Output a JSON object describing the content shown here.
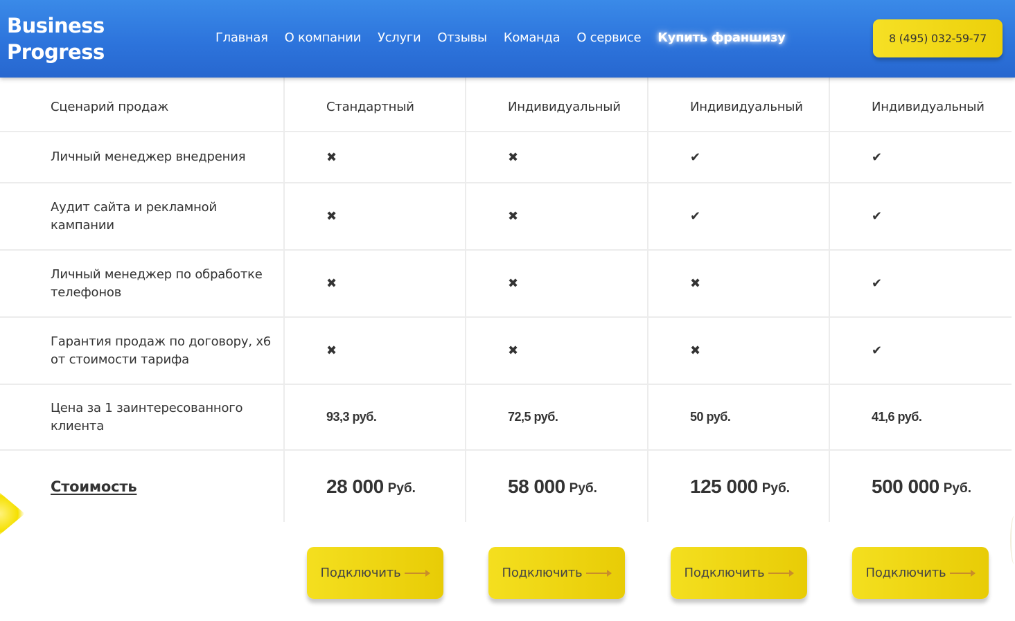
{
  "header": {
    "logo_line1": "Business",
    "logo_line2": "Progress",
    "nav": [
      {
        "label": "Главная"
      },
      {
        "label": "О компании"
      },
      {
        "label": "Услуги"
      },
      {
        "label": "Отзывы"
      },
      {
        "label": "Команда"
      },
      {
        "label": "О сервисе"
      },
      {
        "label": "Купить франшизу"
      }
    ],
    "phone": "8 (495) 032-59-77"
  },
  "table": {
    "rows": [
      {
        "label": "Сценарий продаж",
        "values": [
          "Стандартный",
          "Индивидуальный",
          "Индивидуальный",
          "Индивидуальный"
        ]
      },
      {
        "label": "Личный менеджер внедрения",
        "marks": [
          "cross",
          "cross",
          "check",
          "check"
        ]
      },
      {
        "label": "Аудит сайта и рекламной кампании",
        "marks": [
          "cross",
          "cross",
          "check",
          "check"
        ]
      },
      {
        "label": "Личный менеджер по обработке телефонов",
        "marks": [
          "cross",
          "cross",
          "cross",
          "check"
        ]
      },
      {
        "label": "Гарантия продаж по договору, х6 от стоимости тарифа",
        "marks": [
          "cross",
          "cross",
          "cross",
          "check"
        ]
      },
      {
        "label": "Цена за 1 заинтересованного клиента",
        "values": [
          "93,3 руб.",
          "72,5 руб.",
          "50 руб.",
          "41,6 руб."
        ]
      }
    ],
    "cost": {
      "label": "Стоимость",
      "unit": "Руб.",
      "values": [
        "28 000",
        "58 000",
        "125 000",
        "500 000"
      ]
    },
    "glyphs": {
      "cross": "✖",
      "check": "✔"
    }
  },
  "cta": {
    "label": "Подключить"
  }
}
